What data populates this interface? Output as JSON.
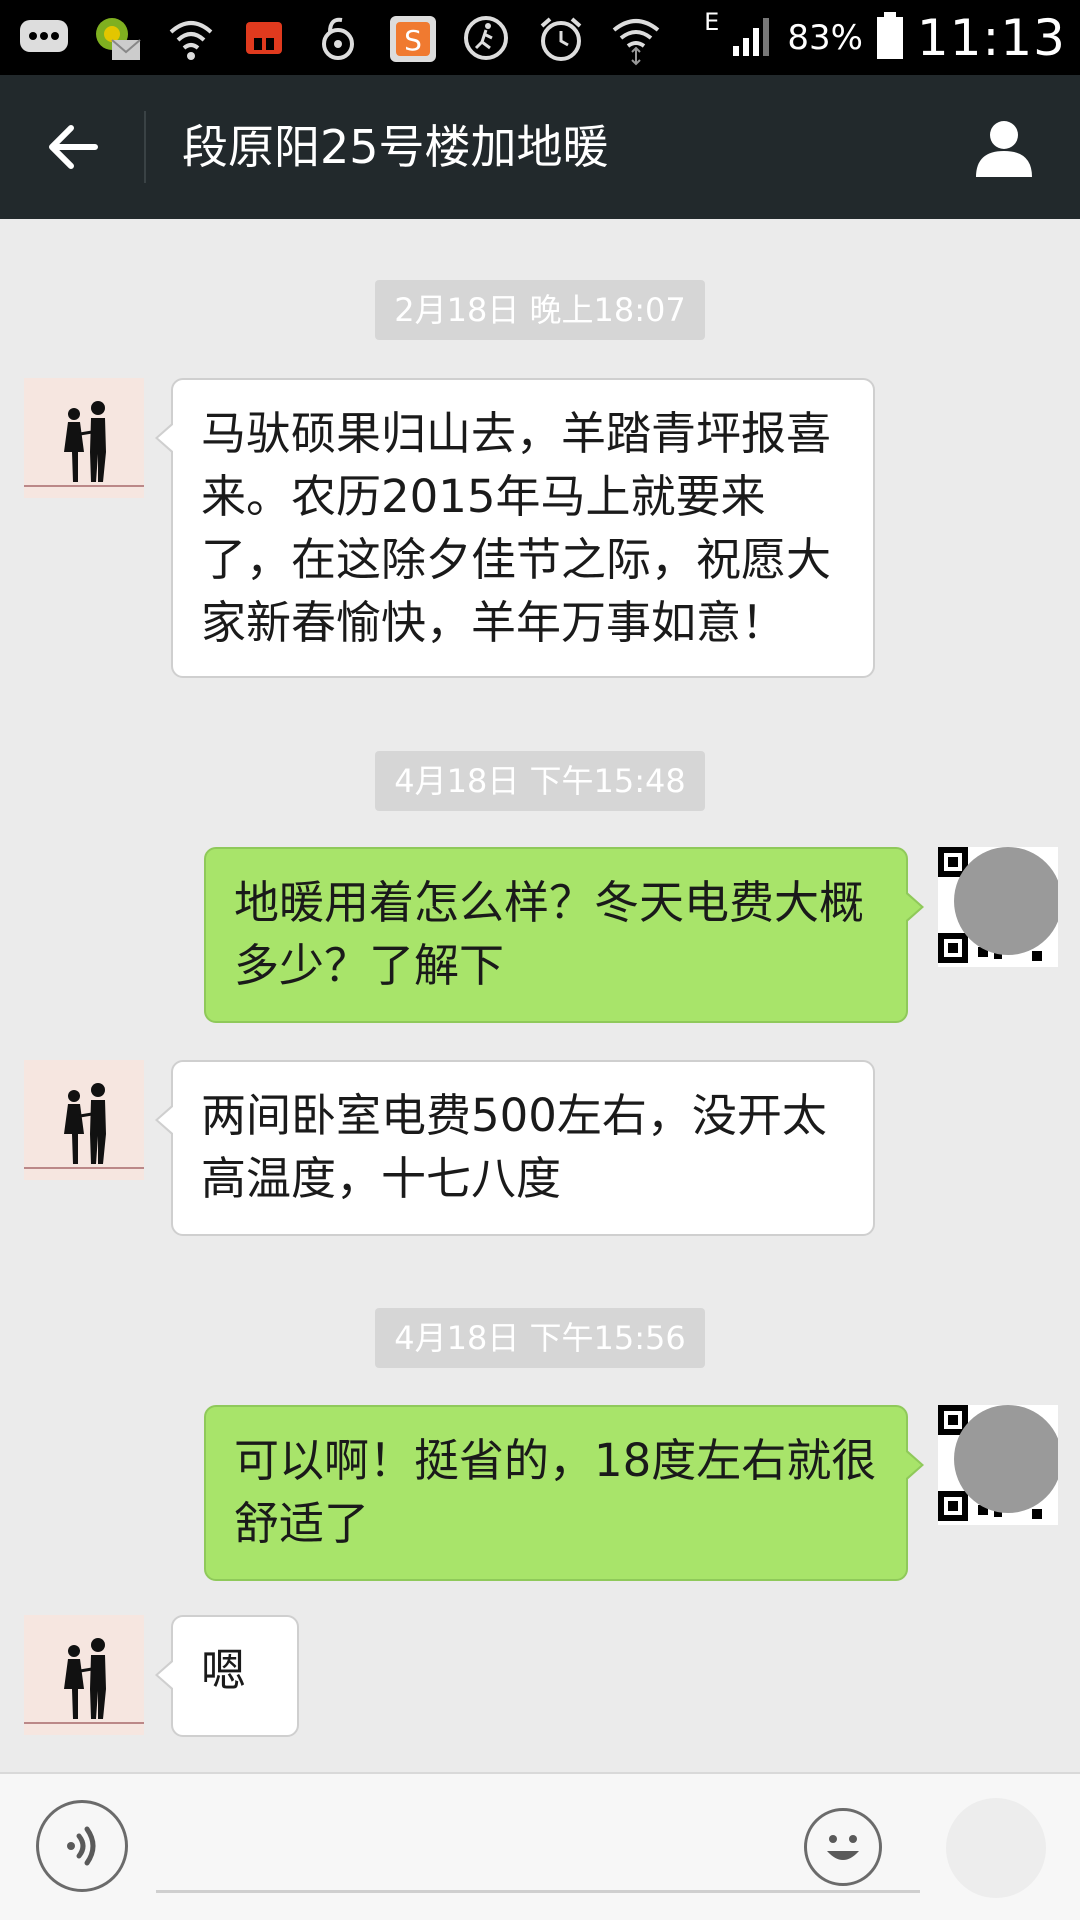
{
  "status_bar": {
    "battery_percent": "83%",
    "clock": "11:13",
    "network_label": "E",
    "icons": [
      "message-icon",
      "email-icon",
      "wifi-signal-icon",
      "shop-icon",
      "lock-icon",
      "sogou-icon",
      "runner-icon",
      "alarm-icon",
      "wifi-icon",
      "cell-signal-icon",
      "battery-icon"
    ]
  },
  "header": {
    "title": "段原阳25号楼加地暖",
    "back_icon": "arrow-left-icon",
    "profile_icon": "person-icon"
  },
  "messages": [
    {
      "type": "timestamp",
      "text": "2月18日 晚上18:07"
    },
    {
      "type": "incoming",
      "text": "马驮硕果归山去，羊踏青坪报喜来。农历2015年马上就要来了，在这除夕佳节之际，祝愿大家新春愉快，羊年万事如意！"
    },
    {
      "type": "timestamp",
      "text": "4月18日 下午15:48"
    },
    {
      "type": "outgoing",
      "text": "地暖用着怎么样？冬天电费大概多少？了解下"
    },
    {
      "type": "incoming",
      "text": "两间卧室电费500左右，没开太高温度，十七八度"
    },
    {
      "type": "timestamp",
      "text": "4月18日 下午15:56"
    },
    {
      "type": "outgoing",
      "text": "可以啊！挺省的，18度左右就很舒适了"
    },
    {
      "type": "incoming",
      "text": "嗯"
    }
  ],
  "colors": {
    "title_bar": "#22292c",
    "chat_background": "#ebebeb",
    "outgoing_bubble": "#a8e46a",
    "incoming_bubble": "#ffffff",
    "timestamp_pill": "#d6d6d6"
  },
  "input_bar": {
    "input_value": "",
    "voice_icon": "voice-icon",
    "emoji_icon": "emoji-icon",
    "more_icon": "more-icon"
  }
}
